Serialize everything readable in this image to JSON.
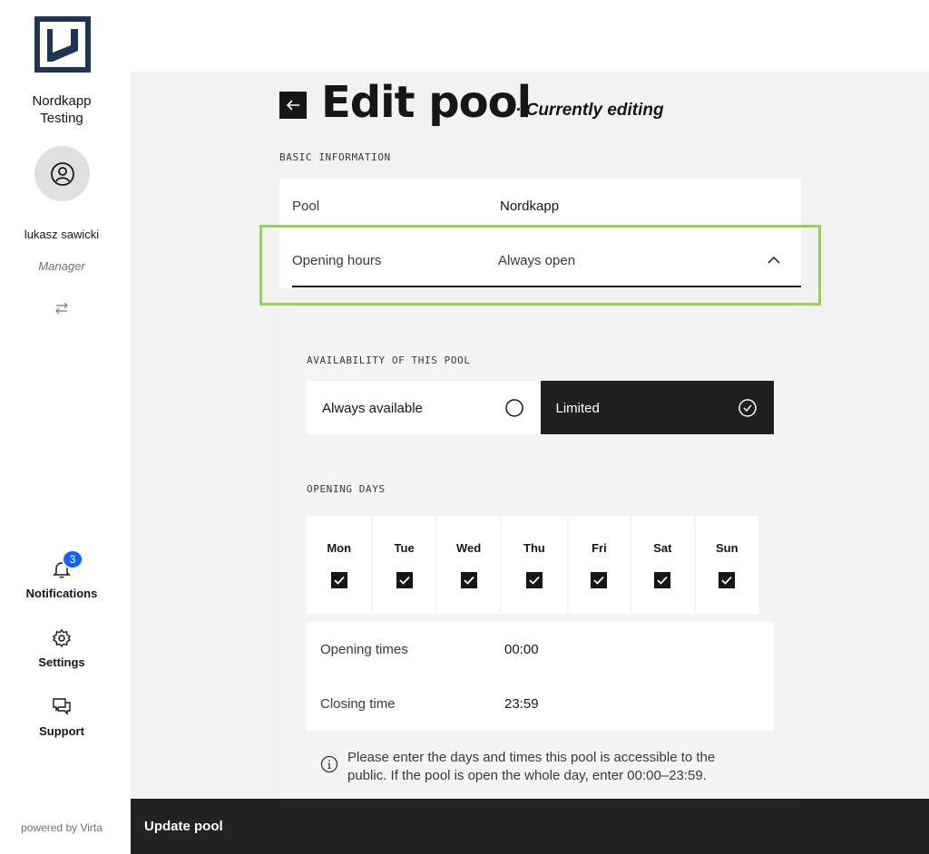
{
  "app": {
    "org_name_line1": "Nordkapp",
    "org_name_line2": "Testing",
    "user_name": "lukasz sawicki",
    "user_role": "Manager",
    "powered_by": "powered by Virta",
    "brand_color": "#1e3553"
  },
  "nav": {
    "notifications_label": "Notifications",
    "notifications_count": "3",
    "settings_label": "Settings",
    "support_label": "Support"
  },
  "header": {
    "title": "Edit pool",
    "subtitle": "· Currently editing"
  },
  "basic_info": {
    "section_label": "BASIC INFORMATION",
    "pool_label": "Pool",
    "pool_value": "Nordkapp",
    "hours_label": "Opening hours",
    "hours_value": "Always open"
  },
  "availability": {
    "section_label": "AVAILABILITY OF THIS POOL",
    "options": [
      "Always available",
      "Limited"
    ],
    "selected": "Limited"
  },
  "opening_days": {
    "section_label": "OPENING DAYS",
    "days": [
      "Mon",
      "Tue",
      "Wed",
      "Thu",
      "Fri",
      "Sat",
      "Sun"
    ],
    "checked": [
      true,
      true,
      true,
      true,
      true,
      true,
      true
    ]
  },
  "times": {
    "opening_label": "Opening times",
    "opening_value": "00:00",
    "closing_label": "Closing time",
    "closing_value": "23:59"
  },
  "info": {
    "line1": "Please enter the days and times this pool is accessible to the",
    "line2": "public. If the pool is open the whole day, enter 00:00–23:59."
  },
  "footer": {
    "update_label": "Update pool"
  },
  "colors": {
    "highlight": "#9acd6a",
    "badge": "#0f62fe",
    "dark": "#161616"
  }
}
